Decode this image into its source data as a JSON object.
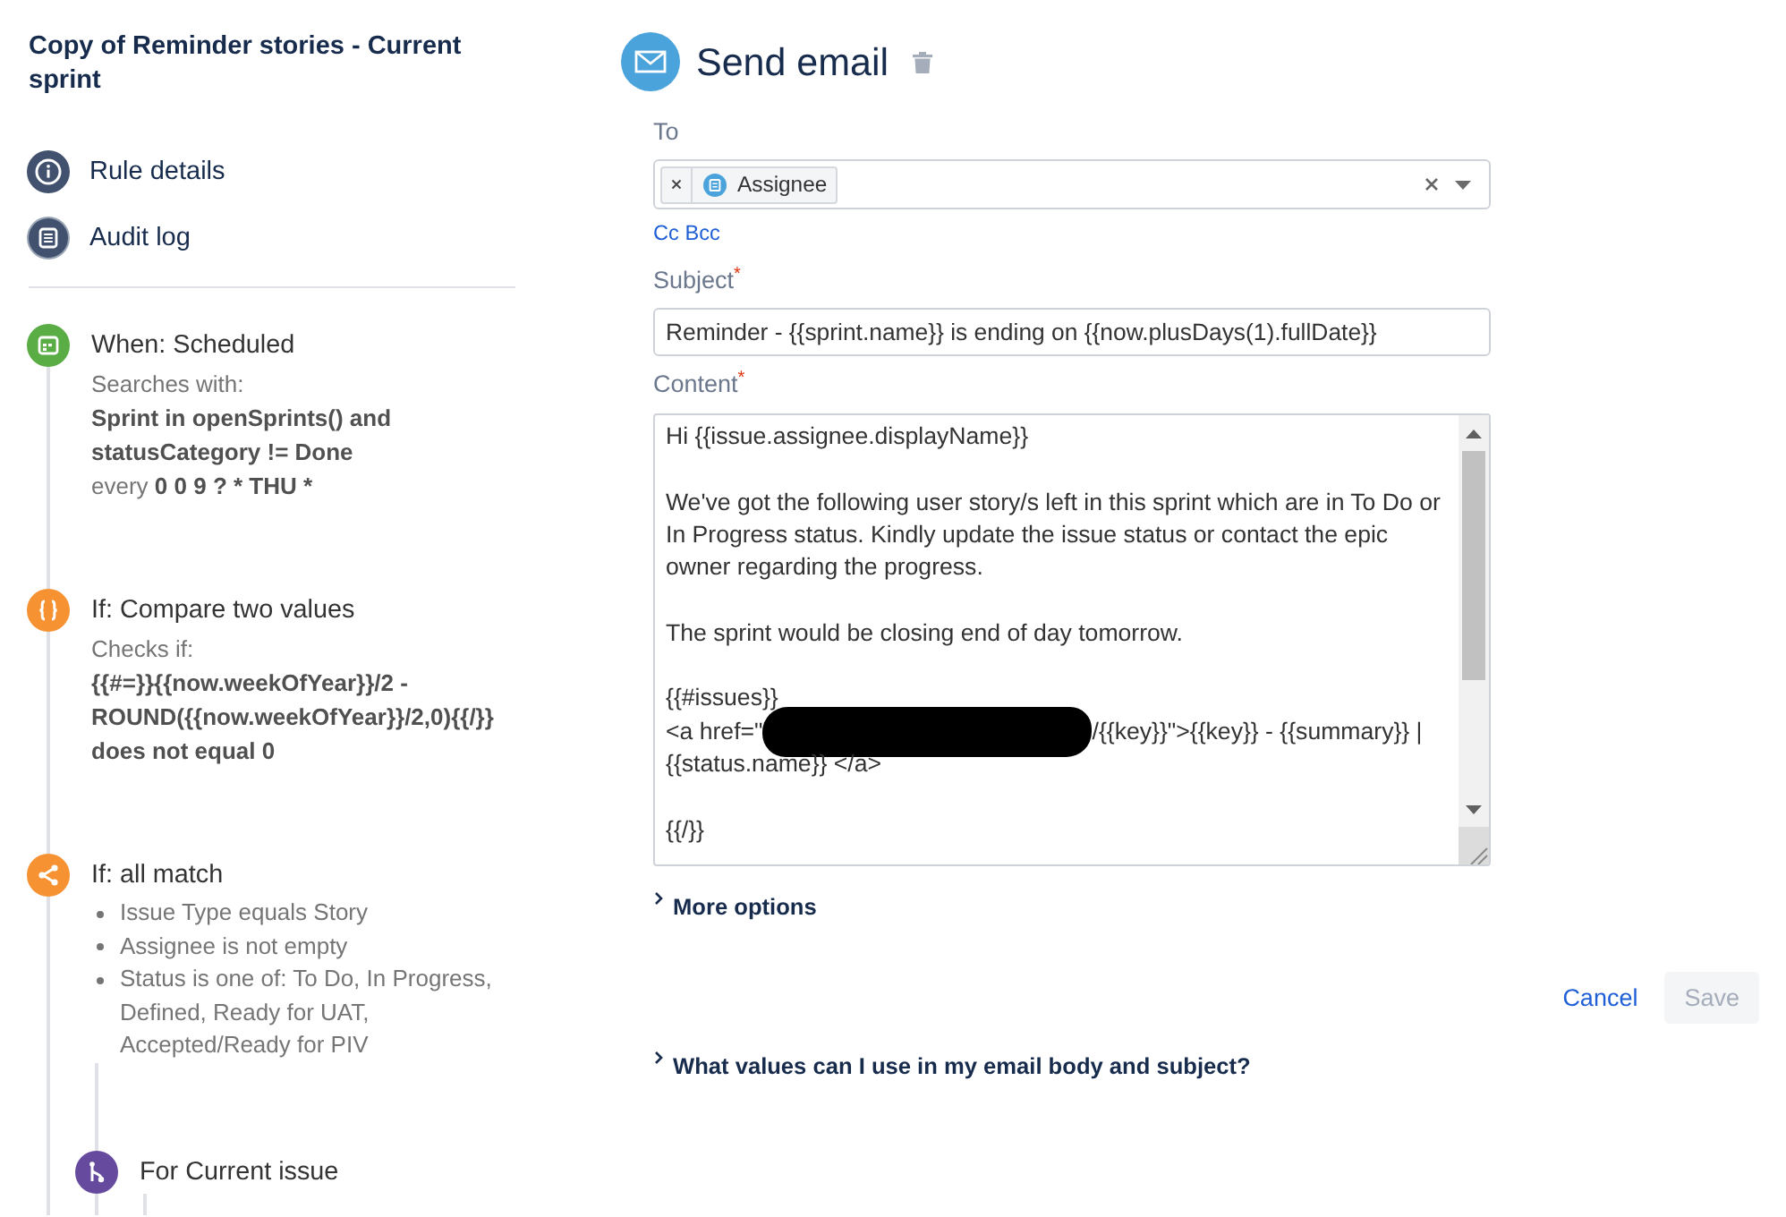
{
  "rule": {
    "title": "Copy of Reminder stories - Current sprint"
  },
  "nav": [
    {
      "kind": "details",
      "label": "Rule details"
    },
    {
      "kind": "audit",
      "label": "Audit log"
    }
  ],
  "steps": [
    {
      "kind": "trigger",
      "title": "When: Scheduled",
      "details": [
        {
          "kind": "label",
          "text": "Searches with:"
        },
        {
          "kind": "value",
          "text": "Sprint in openSprints() and statusCategory != Done"
        },
        {
          "kind": "schedule",
          "prefix": "every",
          "value": "0 0 9 ? * THU *"
        }
      ]
    },
    {
      "kind": "condition",
      "title": "If: Compare two values",
      "details": [
        {
          "kind": "label",
          "text": "Checks if:"
        },
        {
          "kind": "value",
          "text": "{{#=}}{{now.weekOfYear}}/2 - ROUND({{now.weekOfYear}}/2,0){{/}}"
        },
        {
          "kind": "value",
          "text": "does not equal 0"
        }
      ]
    },
    {
      "kind": "condition-group",
      "title": "If: all match",
      "conditions": [
        "Issue Type equals Story",
        "Assignee is not empty",
        "Status is one of: To Do, In Progress, Defined, Ready for UAT, Accepted/Ready for PIV"
      ],
      "children": [
        {
          "kind": "branch",
          "title": "For Current issue"
        }
      ]
    }
  ],
  "action": {
    "title": "Send email",
    "to": {
      "label": "To",
      "recipients": [
        {
          "label": "Assignee"
        }
      ]
    },
    "cc_bcc": "Cc Bcc",
    "subject": {
      "label": "Subject$^{*}$",
      "value": "Reminder - {{sprint.name}} is ending on {{now.plusDays(1).fullDate}}"
    },
    "content": {
      "label": "Content$^{*}$",
      "blocks": [
        [
          {
            "kind": "text",
            "lines": [
              "Hi {{issue.assignee.displayName}}"
            ]
          }
        ],
        [
          {
            "kind": "text",
            "lines": [
              "We've got the following user story/s left in this sprint which are in To Do or",
              "In Progress status. Kindly update the issue status or contact the epic",
              "owner regarding the progress."
            ]
          }
        ],
        [
          {
            "kind": "text",
            "lines": [
              "The sprint would be closing end of day tomorrow."
            ]
          }
        ],
        [
          {
            "kind": "text",
            "lines": [
              "{{#issues}}"
            ]
          },
          {
            "kind": "redacted",
            "before": "<a href=\"",
            "after": "/{{key}}\">{{key}} - {{summary}} |"
          },
          {
            "kind": "text",
            "lines": [
              "{{status.name}} </a>"
            ]
          }
        ],
        [
          {
            "kind": "text",
            "lines": [
              "{{/}}"
            ]
          }
        ]
      ]
    },
    "more_options": {
      "label": "More options",
      "expanded": false
    },
    "cancel": "Cancel",
    "save": {
      "label": "Save",
      "disabled": true
    },
    "help": {
      "label": "What values can I use in my email body and subject?",
      "expanded": false
    }
  }
}
